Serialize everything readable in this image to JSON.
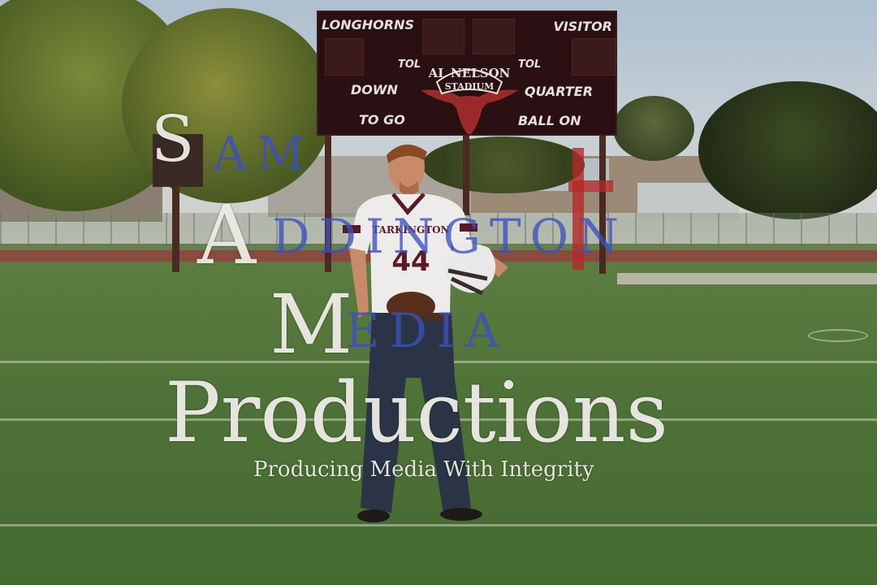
{
  "scoreboard": {
    "home_label": "LONGHORNS",
    "visitor_label": "VISITOR",
    "tol_left": "TOL",
    "tol_right": "TOL",
    "down_label": "DOWN",
    "quarter_label": "QUARTER",
    "to_go_label": "TO GO",
    "ball_on_label": "BALL ON",
    "stadium_line_1": "AL NELSON",
    "stadium_line_2": "STADIUM"
  },
  "jersey": {
    "team": "TARKINGTON",
    "number": "44"
  },
  "watermark": {
    "line1_initial": "S",
    "line1_rest": "AM",
    "line2_initial": "A",
    "line2_rest": "DDINGTON",
    "line3_initial": "M",
    "line3_rest": "EDIA",
    "line4": "Productions",
    "tagline": "Producing Media With Integrity"
  },
  "colors": {
    "scoreboard_bg": "#2a1012",
    "jersey_maroon": "#5a1a2a",
    "watermark_blue": "#3c50be",
    "watermark_white": "#f5f3ee",
    "cross_red": "#b42828",
    "grass": "#4f7238"
  }
}
